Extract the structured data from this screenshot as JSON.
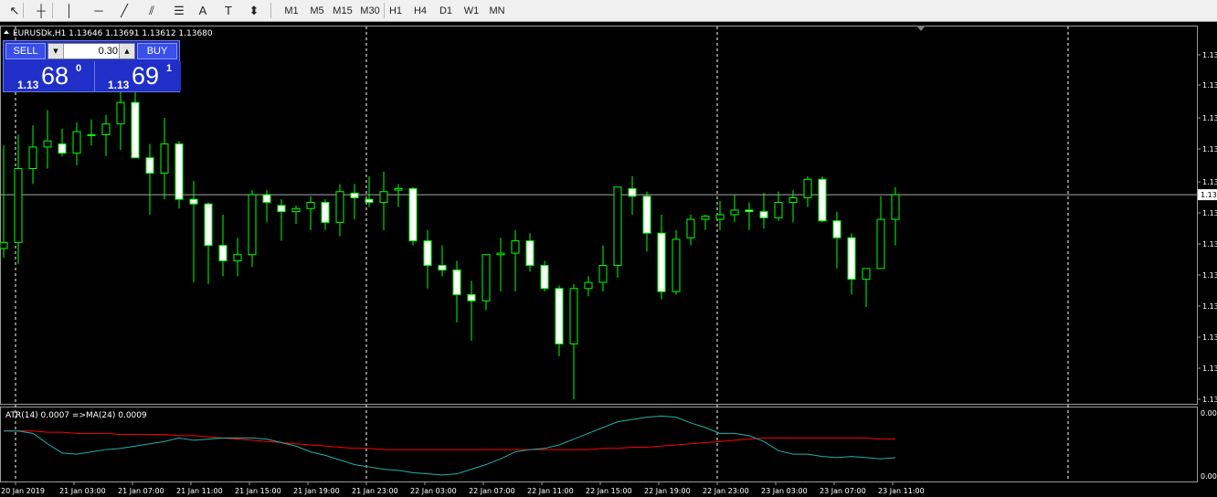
{
  "toolbar": {
    "tools": [
      {
        "name": "cursor-icon",
        "glyph": "↖"
      },
      {
        "name": "crosshair-icon",
        "glyph": "┼"
      },
      {
        "name": "vertical-line-icon",
        "glyph": "│"
      },
      {
        "name": "horizontal-line-icon",
        "glyph": "─"
      },
      {
        "name": "trendline-icon",
        "glyph": "╱"
      },
      {
        "name": "equidistant-channel-icon",
        "glyph": "⫽"
      },
      {
        "name": "fibonacci-icon",
        "glyph": "☰"
      },
      {
        "name": "text-icon",
        "glyph": "A"
      },
      {
        "name": "text-label-icon",
        "glyph": "T"
      },
      {
        "name": "arrows-icon",
        "glyph": "⬍"
      }
    ],
    "timeframes": [
      "M1",
      "M5",
      "M15",
      "M30",
      "H1",
      "H4",
      "D1",
      "W1",
      "MN"
    ]
  },
  "chart": {
    "header": "EURUSDk,H1  1.13646 1.13691 1.13612 1.13680",
    "indicator_label": "ATR(14) 0.0007  =>MA(24) 0.0009",
    "price_labels": [
      "1.13",
      "1.13",
      "1.13",
      "1.13",
      "1.13",
      "1.13",
      "1.13",
      "1.13",
      "1.13",
      "1.13",
      "1.13",
      "1.13",
      "1.13"
    ],
    "current_price_label": "1.13",
    "indicator_scale": [
      "0.00",
      "0.00"
    ],
    "time_labels": [
      "20 Jan 2019",
      "21 Jan 03:00",
      "21 Jan 07:00",
      "21 Jan 11:00",
      "21 Jan 15:00",
      "21 Jan 19:00",
      "21 Jan 23:00",
      "22 Jan 03:00",
      "22 Jan 07:00",
      "22 Jan 11:00",
      "22 Jan 15:00",
      "22 Jan 19:00",
      "22 Jan 23:00",
      "23 Jan 03:00",
      "23 Jan 07:00",
      "23 Jan 11:00"
    ],
    "colors": {
      "background": "#000000",
      "bull_body": "#000000",
      "bear_body": "#ffffff",
      "wick": "#00ff00",
      "atr_line": "#20b2aa",
      "ma_line": "#ff0000",
      "grid": "#ffffff"
    }
  },
  "trade_panel": {
    "sell_label": "SELL",
    "buy_label": "BUY",
    "lot": "0.30",
    "sell_prefix": "1.13",
    "sell_main": "68",
    "sell_sup": "0",
    "buy_prefix": "1.13",
    "buy_main": "69",
    "buy_sup": "1"
  },
  "chart_data": {
    "type": "candlestick",
    "symbol": "EURUSDk",
    "timeframe": "H1",
    "price_range": [
      1.1354,
      1.1378
    ],
    "candles": [
      {
        "o": 1.13638,
        "h": 1.13705,
        "l": 1.13632,
        "c": 1.13642
      },
      {
        "o": 1.13642,
        "h": 1.13712,
        "l": 1.13628,
        "c": 1.1369
      },
      {
        "o": 1.1369,
        "h": 1.13718,
        "l": 1.1368,
        "c": 1.13704
      },
      {
        "o": 1.13704,
        "h": 1.13728,
        "l": 1.1369,
        "c": 1.13708
      },
      {
        "o": 1.13706,
        "h": 1.13716,
        "l": 1.13698,
        "c": 1.137
      },
      {
        "o": 1.137,
        "h": 1.1372,
        "l": 1.13692,
        "c": 1.13714
      },
      {
        "o": 1.13712,
        "h": 1.13722,
        "l": 1.13705,
        "c": 1.13712
      },
      {
        "o": 1.13712,
        "h": 1.13725,
        "l": 1.13698,
        "c": 1.13719
      },
      {
        "o": 1.13719,
        "h": 1.13752,
        "l": 1.13702,
        "c": 1.13733
      },
      {
        "o": 1.13733,
        "h": 1.1374,
        "l": 1.13705,
        "c": 1.13697
      },
      {
        "o": 1.13697,
        "h": 1.13706,
        "l": 1.1366,
        "c": 1.13687
      },
      {
        "o": 1.13687,
        "h": 1.13723,
        "l": 1.1367,
        "c": 1.13706
      },
      {
        "o": 1.13706,
        "h": 1.13708,
        "l": 1.13664,
        "c": 1.1367
      },
      {
        "o": 1.1367,
        "h": 1.13682,
        "l": 1.13616,
        "c": 1.13667
      },
      {
        "o": 1.13667,
        "h": 1.13668,
        "l": 1.13615,
        "c": 1.1364
      },
      {
        "o": 1.1364,
        "h": 1.1366,
        "l": 1.1362,
        "c": 1.1363
      },
      {
        "o": 1.1363,
        "h": 1.13645,
        "l": 1.1362,
        "c": 1.13634
      },
      {
        "o": 1.13634,
        "h": 1.13676,
        "l": 1.13626,
        "c": 1.13673
      },
      {
        "o": 1.13673,
        "h": 1.13676,
        "l": 1.13655,
        "c": 1.13668
      },
      {
        "o": 1.13666,
        "h": 1.1367,
        "l": 1.13643,
        "c": 1.13662
      },
      {
        "o": 1.13662,
        "h": 1.13666,
        "l": 1.13654,
        "c": 1.13664
      },
      {
        "o": 1.13664,
        "h": 1.13672,
        "l": 1.1365,
        "c": 1.13668
      },
      {
        "o": 1.13668,
        "h": 1.1367,
        "l": 1.1365,
        "c": 1.13655
      },
      {
        "o": 1.13655,
        "h": 1.1368,
        "l": 1.13646,
        "c": 1.13675
      },
      {
        "o": 1.13674,
        "h": 1.1368,
        "l": 1.13657,
        "c": 1.13671
      },
      {
        "o": 1.1367,
        "h": 1.13685,
        "l": 1.13665,
        "c": 1.13668
      },
      {
        "o": 1.13668,
        "h": 1.13688,
        "l": 1.1365,
        "c": 1.13675
      },
      {
        "o": 1.13676,
        "h": 1.1368,
        "l": 1.13665,
        "c": 1.13677
      },
      {
        "o": 1.13677,
        "h": 1.13678,
        "l": 1.1364,
        "c": 1.13643
      },
      {
        "o": 1.13643,
        "h": 1.1365,
        "l": 1.13612,
        "c": 1.13627
      },
      {
        "o": 1.13627,
        "h": 1.1364,
        "l": 1.1362,
        "c": 1.13624
      },
      {
        "o": 1.13624,
        "h": 1.1363,
        "l": 1.1359,
        "c": 1.13608
      },
      {
        "o": 1.13608,
        "h": 1.13617,
        "l": 1.13578,
        "c": 1.13604
      },
      {
        "o": 1.13604,
        "h": 1.13634,
        "l": 1.13598,
        "c": 1.13634
      },
      {
        "o": 1.13634,
        "h": 1.13645,
        "l": 1.1361,
        "c": 1.13635
      },
      {
        "o": 1.13635,
        "h": 1.1365,
        "l": 1.1361,
        "c": 1.13643
      },
      {
        "o": 1.13643,
        "h": 1.13648,
        "l": 1.13623,
        "c": 1.13627
      },
      {
        "o": 1.13627,
        "h": 1.1363,
        "l": 1.1361,
        "c": 1.13612
      },
      {
        "o": 1.13612,
        "h": 1.13614,
        "l": 1.13568,
        "c": 1.13576
      },
      {
        "o": 1.13576,
        "h": 1.13615,
        "l": 1.1354,
        "c": 1.13612
      },
      {
        "o": 1.13612,
        "h": 1.1362,
        "l": 1.13607,
        "c": 1.13616
      },
      {
        "o": 1.13616,
        "h": 1.1364,
        "l": 1.1361,
        "c": 1.13627
      },
      {
        "o": 1.13627,
        "h": 1.13664,
        "l": 1.13619,
        "c": 1.13678
      },
      {
        "o": 1.13677,
        "h": 1.13685,
        "l": 1.1366,
        "c": 1.13672
      },
      {
        "o": 1.13672,
        "h": 1.13675,
        "l": 1.13636,
        "c": 1.13648
      },
      {
        "o": 1.13648,
        "h": 1.1366,
        "l": 1.13605,
        "c": 1.1361
      },
      {
        "o": 1.1361,
        "h": 1.1365,
        "l": 1.13608,
        "c": 1.13644
      },
      {
        "o": 1.13645,
        "h": 1.1366,
        "l": 1.1364,
        "c": 1.13657
      },
      {
        "o": 1.13657,
        "h": 1.1366,
        "l": 1.1365,
        "c": 1.13659
      },
      {
        "o": 1.13657,
        "h": 1.13669,
        "l": 1.1365,
        "c": 1.1366
      },
      {
        "o": 1.1366,
        "h": 1.13673,
        "l": 1.13655,
        "c": 1.13663
      },
      {
        "o": 1.13663,
        "h": 1.13668,
        "l": 1.1365,
        "c": 1.13662
      },
      {
        "o": 1.13662,
        "h": 1.13674,
        "l": 1.13651,
        "c": 1.13658
      },
      {
        "o": 1.13658,
        "h": 1.13675,
        "l": 1.13656,
        "c": 1.13668
      },
      {
        "o": 1.13668,
        "h": 1.13676,
        "l": 1.13655,
        "c": 1.13671
      },
      {
        "o": 1.13671,
        "h": 1.13685,
        "l": 1.13665,
        "c": 1.13683
      },
      {
        "o": 1.13683,
        "h": 1.13685,
        "l": 1.13655,
        "c": 1.13656
      },
      {
        "o": 1.13656,
        "h": 1.13662,
        "l": 1.13625,
        "c": 1.13645
      },
      {
        "o": 1.13645,
        "h": 1.13648,
        "l": 1.13608,
        "c": 1.13618
      },
      {
        "o": 1.13618,
        "h": 1.13623,
        "l": 1.136,
        "c": 1.13625
      },
      {
        "o": 1.13625,
        "h": 1.13672,
        "l": 1.13625,
        "c": 1.13657
      },
      {
        "o": 1.13657,
        "h": 1.13678,
        "l": 1.1364,
        "c": 1.13673
      }
    ],
    "atr": {
      "label": "ATR(14)",
      "value": 0.0007
    },
    "atr_ma": {
      "label": "MA(24)",
      "value": 0.0009
    },
    "atr_series": [
      0.00112,
      0.00112,
      0.0011,
      0.00101,
      0.00093,
      0.00092,
      0.00094,
      0.00096,
      0.00097,
      0.00099,
      0.00101,
      0.00103,
      0.00106,
      0.00104,
      0.00105,
      0.00106,
      0.00106,
      0.00106,
      0.00105,
      0.00102,
      0.00099,
      0.00094,
      0.00091,
      0.00087,
      0.00083,
      0.00081,
      0.00079,
      0.00078,
      0.00076,
      0.00075,
      0.00074,
      0.00075,
      0.00079,
      0.00083,
      0.00088,
      0.00094,
      0.00096,
      0.00097,
      0.001,
      0.00105,
      0.0011,
      0.00115,
      0.0012,
      0.00122,
      0.00124,
      0.00125,
      0.00124,
      0.00119,
      0.00115,
      0.0011,
      0.0011,
      0.00108,
      0.00103,
      0.00095,
      0.00092,
      0.00092,
      0.0009,
      0.00089,
      0.0009,
      0.00089,
      0.00088,
      0.00089
    ],
    "ma_series": [
      0.00112,
      0.00112,
      0.00112,
      0.00111,
      0.00111,
      0.0011,
      0.0011,
      0.0011,
      0.00109,
      0.00109,
      0.00109,
      0.00109,
      0.00108,
      0.00108,
      0.00107,
      0.00106,
      0.00105,
      0.00104,
      0.00103,
      0.00102,
      0.00101,
      0.001,
      0.00099,
      0.00098,
      0.00097,
      0.00097,
      0.00096,
      0.00096,
      0.00096,
      0.00096,
      0.00096,
      0.00096,
      0.00096,
      0.00096,
      0.00096,
      0.00096,
      0.00096,
      0.00096,
      0.00096,
      0.00096,
      0.00096,
      0.00097,
      0.00097,
      0.00098,
      0.00098,
      0.00099,
      0.001,
      0.00101,
      0.00102,
      0.00103,
      0.00104,
      0.00105,
      0.00106,
      0.00106,
      0.00106,
      0.00106,
      0.00106,
      0.00106,
      0.00106,
      0.00106,
      0.00105,
      0.00105
    ],
    "atr_range": [
      0.0007,
      0.0013
    ],
    "x_labels": [
      "20 Jan 2019",
      "21 Jan 03:00",
      "21 Jan 07:00",
      "21 Jan 11:00",
      "21 Jan 15:00",
      "21 Jan 19:00",
      "21 Jan 23:00",
      "22 Jan 03:00",
      "22 Jan 07:00",
      "22 Jan 11:00",
      "22 Jan 15:00",
      "22 Jan 19:00",
      "22 Jan 23:00",
      "23 Jan 03:00",
      "23 Jan 07:00",
      "23 Jan 11:00"
    ]
  }
}
